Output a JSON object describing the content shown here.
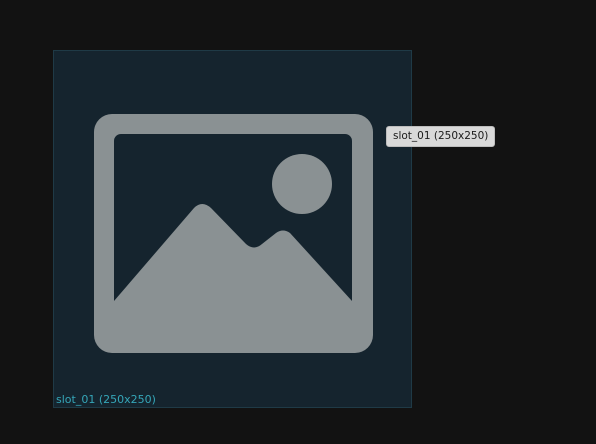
{
  "slot": {
    "caption": "slot_01 (250x250)",
    "icon": "image-placeholder-icon"
  },
  "tooltip": {
    "text": "slot_01 (250x250)"
  },
  "colors": {
    "background": "#121212",
    "slot_fill": "#15242e",
    "icon_fill": "#8a9193",
    "caption": "#35a6b8",
    "tooltip_bg": "#d9d9d9"
  }
}
